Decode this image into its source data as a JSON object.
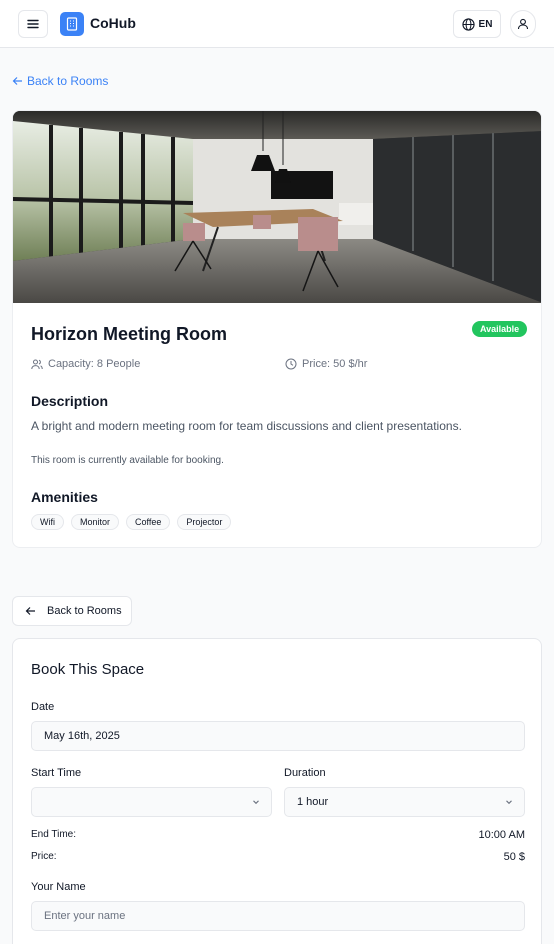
{
  "header": {
    "brand": "CoHub",
    "lang": "EN",
    "icons": {
      "menu": "menu-icon",
      "logo": "building-icon",
      "lang": "globe-icon",
      "user": "user-icon"
    }
  },
  "back_link": {
    "label": "Back to Rooms"
  },
  "room": {
    "name": "Horizon Meeting Room",
    "status": "Available",
    "capacity": "Capacity: 8 People",
    "price": "Price: 50 $/hr",
    "description_title": "Description",
    "description": "A bright and modern meeting room for team discussions and client presentations.",
    "availability_note": "This room is currently available for booking.",
    "amenities_title": "Amenities",
    "amenities": [
      "Wifi",
      "Monitor",
      "Coffee",
      "Projector"
    ]
  },
  "back_button": {
    "label": "Back to Rooms"
  },
  "booking": {
    "title": "Book This Space",
    "date_label": "Date",
    "date_value": "May 16th, 2025",
    "start_time_label": "Start Time",
    "start_time_value": "",
    "duration_label": "Duration",
    "duration_value": "1 hour",
    "end_time_label": "End Time:",
    "end_time_value": "10:00 AM",
    "price_label": "Price:",
    "price_value": "50 $",
    "name_label": "Your Name",
    "name_placeholder": "Enter your name"
  },
  "colors": {
    "accent": "#3b82f6",
    "available": "#22c55e",
    "background": "#f9fafb"
  }
}
